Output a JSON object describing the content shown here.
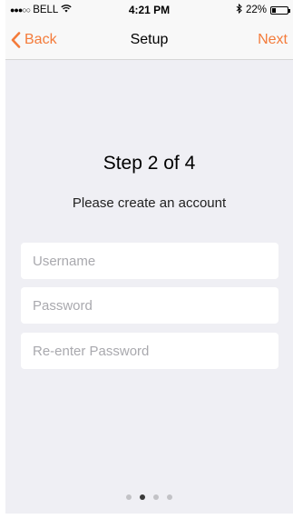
{
  "status_bar": {
    "signal": "●●●○○",
    "carrier": "BELL",
    "wifi_icon": "wifi-icon",
    "time": "4:21 PM",
    "bluetooth_icon": "bluetooth-icon",
    "battery_percent": "22%",
    "battery_level": 0.22
  },
  "nav": {
    "back_label": "Back",
    "title": "Setup",
    "next_label": "Next",
    "accent_color": "#f47b3a"
  },
  "content": {
    "step_title": "Step 2 of 4",
    "subtitle": "Please create an account"
  },
  "form": {
    "username": {
      "placeholder": "Username",
      "value": ""
    },
    "password": {
      "placeholder": "Password",
      "value": ""
    },
    "reenter_password": {
      "placeholder": "Re-enter Password",
      "value": ""
    }
  },
  "pager": {
    "total": 4,
    "current": 2
  }
}
